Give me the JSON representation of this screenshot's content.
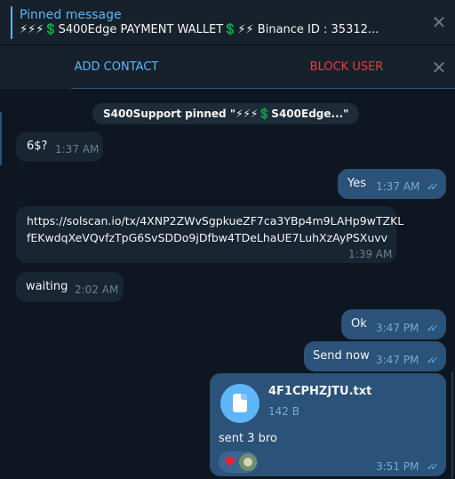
{
  "pinned": {
    "title": "Pinned message",
    "text": "⚡⚡⚡💲S400Edge PAYMENT WALLET💲⚡⚡  Binance ID : 35312..."
  },
  "actions": {
    "add_contact": "ADD CONTACT",
    "block_user": "BLOCK USER"
  },
  "service_message": "S400Support pinned \"⚡⚡⚡💲S400Edge...\"",
  "messages": [
    {
      "text": "6$?",
      "time": "1:37 AM"
    },
    {
      "text": "Yes",
      "time": "1:37 AM"
    },
    {
      "text_line1": "https://solscan.io/tx/4XNP2ZWvSgpkueZF7ca3YBp4m9LAHp9wTZKL",
      "text_line2": "fEKwdqXeVQvfzTpG6SvSDDo9jDfbw4TDeLhaUE7LuhXzAyPSXuvv",
      "time": "1:39 AM"
    },
    {
      "text": "waiting",
      "time": "2:02 AM"
    },
    {
      "text": "Ok",
      "time": "3:47 PM"
    },
    {
      "text": "Send now",
      "time": "3:47 PM"
    },
    {
      "file_name": "4F1CPHZJTU.txt",
      "file_size": "142 B",
      "caption": "sent 3 bro",
      "time": "3:51 PM"
    }
  ],
  "icons": {
    "close": "close-icon",
    "checkmarks": "double-check-icon",
    "file": "file-icon",
    "heart": "heart-reaction-icon"
  },
  "colors": {
    "background": "#0e1621",
    "incoming_bubble": "#182533",
    "outgoing_bubble": "#2b5278",
    "accent": "#5eb5f7",
    "danger": "#ec3942"
  }
}
